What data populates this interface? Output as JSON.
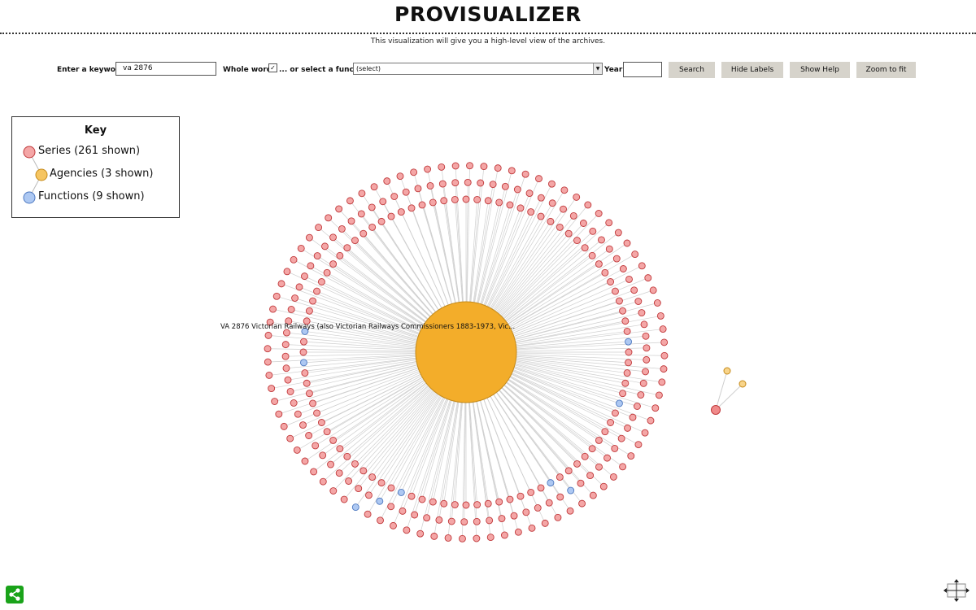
{
  "header": {
    "title": "PROVISUALIZER",
    "subtitle": "This visualization will give you a high-level view of the archives."
  },
  "toolbar": {
    "keyword_label": "Enter a keyword:",
    "keyword_value": "va 2876",
    "whole_words_label": "Whole words",
    "whole_words_checked": true,
    "function_label": "... or select a function:",
    "function_selected": "(select)",
    "year_label": "Year:",
    "year_value": "",
    "search_label": "Search",
    "hide_labels_label": "Hide Labels",
    "show_help_label": "Show Help",
    "zoom_label": "Zoom to fit"
  },
  "key": {
    "title": "Key",
    "series_label": "Series (261 shown)",
    "agencies_label": "Agencies (3 shown)",
    "functions_label": "Functions (9 shown)"
  },
  "graph": {
    "center_label": "VA 2876 Victorian Railways (also Victorian Railways Commissioners 1883-1973, Vic...",
    "series_count": 261,
    "agencies_count": 3,
    "functions_count": 9
  },
  "colors": {
    "series_fill": "#f4a6a6",
    "series_stroke": "#c0393b",
    "agency_fill": "#f3ad2a",
    "agency_stroke": "#c58a1a",
    "function_fill": "#adc8f2",
    "function_stroke": "#4d78c0",
    "link": "#cfcfcf",
    "button_bg": "#d6d3cb",
    "share_green": "#1aa31a"
  },
  "icons": {
    "share": "share-icon",
    "resize": "resize-arrows-icon",
    "dropdown": "dropdown-arrow-icon"
  }
}
